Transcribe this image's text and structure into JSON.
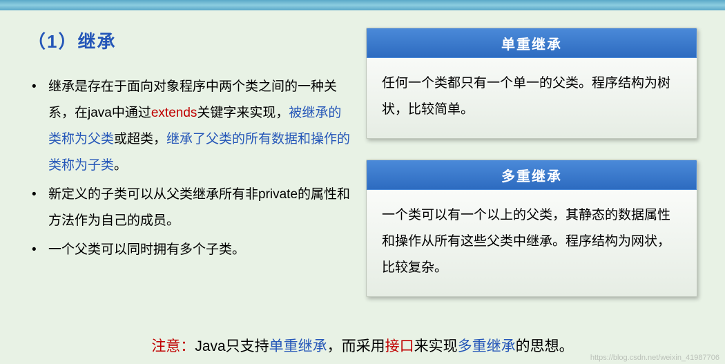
{
  "title": "（1）继承",
  "bullets": {
    "b1p1": "继承是存在于面向对象程序中两个类之间的一种关系，在java中通过",
    "b1red": "extends",
    "b1p2": "关键字来实现，",
    "b1blue1": "被继承的类称为父类",
    "b1p3": "或超类，",
    "b1blue2": "继承了父类的所有数据和操作的类称为子类",
    "b1p4": "。",
    "b2": "新定义的子类可以从父类继承所有非private的属性和方法作为自己的成员。",
    "b3": "一个父类可以同时拥有多个子类。"
  },
  "cards": {
    "single": {
      "header": "单重继承",
      "body": "任何一个类都只有一个单一的父类。程序结构为树状，比较简单。"
    },
    "multi": {
      "header": "多重继承",
      "body": "一个类可以有一个以上的父类，其静态的数据属性和操作从所有这些父类中继承。程序结构为网状，比较复杂。"
    }
  },
  "footer": {
    "p1": "注意：",
    "p2": "Java只支持",
    "p3": "单重继承",
    "p4": "，而采用",
    "p5": "接口",
    "p6": "来实现",
    "p7": "多重继承",
    "p8": "的思想。"
  },
  "watermark": "https://blog.csdn.net/weixin_41987706"
}
